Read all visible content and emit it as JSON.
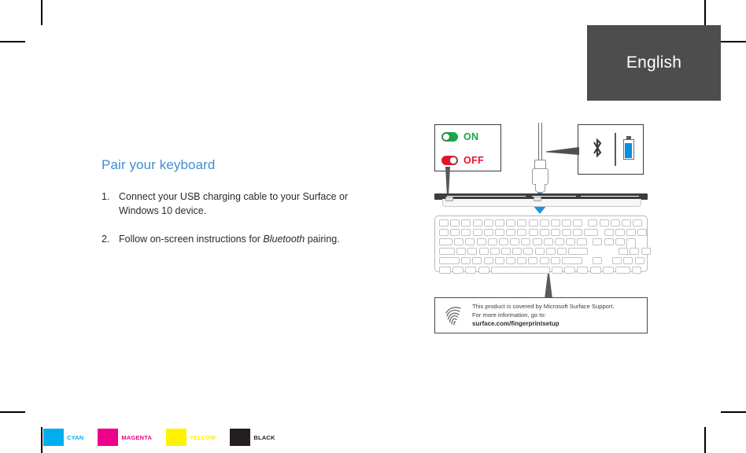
{
  "language_tab": {
    "label": "English"
  },
  "instructions": {
    "title": "Pair your keyboard",
    "steps": [
      {
        "num": "1.",
        "text_before": "Connect your USB charging cable to your Surface or Windows 10 device.",
        "emphasis": "",
        "text_after": ""
      },
      {
        "num": "2.",
        "text_before": "Follow on-screen instructions for ",
        "emphasis": "Bluetooth",
        "text_after": " pairing."
      }
    ]
  },
  "diagram": {
    "power_switch": {
      "on_label": "ON",
      "off_label": "OFF",
      "on_color": "#17a84a",
      "off_color": "#e8112d"
    },
    "connectivity_panel": {
      "bluetooth_icon": "bluetooth-icon",
      "battery_icon": "battery-icon",
      "battery_color": "#0a8ee0"
    },
    "cable": {
      "icon": "usb-c-cable-icon"
    },
    "arrow_to_port": {
      "icon": "arrow-down-icon",
      "color": "#1a93dd"
    },
    "keyboard": {
      "icon": "keyboard-illustration"
    },
    "info_box": {
      "icon": "fingerprint-icon",
      "line1": "This product is covered by Microsoft Surface Support.",
      "line2": "For more information, go to:",
      "url": "surface.com/fingerprintsetup"
    }
  },
  "print_marks": {
    "swatches": [
      {
        "label": "CYAN",
        "color": "#00AEEF"
      },
      {
        "label": "MAGENTA",
        "color": "#EC008C"
      },
      {
        "label": "YELLOW",
        "color": "#FFF200"
      },
      {
        "label": "BLACK",
        "color": "#231F20"
      }
    ]
  }
}
